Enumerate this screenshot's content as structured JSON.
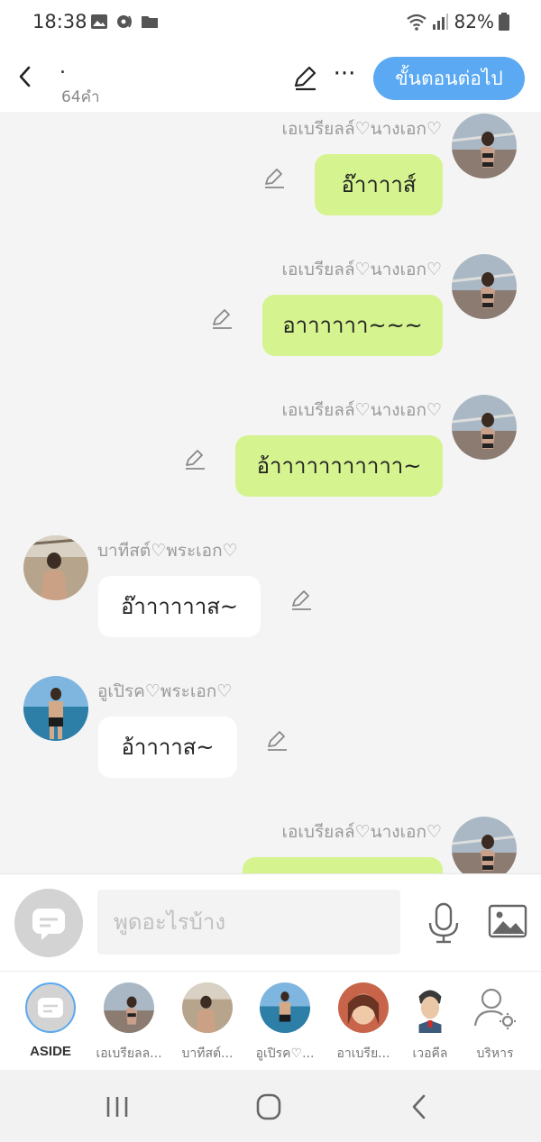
{
  "status_bar": {
    "time": "18:38",
    "battery": "82%"
  },
  "header": {
    "title": ".",
    "word_count": "64คำ",
    "next_label": "ขั้นตอนต่อไป"
  },
  "messages": [
    {
      "sender": "เอเบรียลล์♡นางเอก♡",
      "text": "อ๊าาาาส์",
      "side": "right"
    },
    {
      "sender": "เอเบรียลล์♡นางเอก♡",
      "text": "อาาาาาา~~~",
      "side": "right"
    },
    {
      "sender": "เอเบรียลล์♡นางเอก♡",
      "text": "อ้าาาาาาาาาาา~",
      "side": "right"
    },
    {
      "sender": "บาทีสต์♡พระเอก♡",
      "text": "อ๊าาาาาาส~",
      "side": "left"
    },
    {
      "sender": "อูเปิรค♡พระเอก♡",
      "text": "อ้าาาาส~",
      "side": "left"
    },
    {
      "sender": "เอเบรียลล์♡นางเอก♡",
      "text": "",
      "side": "right"
    }
  ],
  "input": {
    "placeholder": "พูดอะไรบ้าง"
  },
  "characters": [
    {
      "label": "ASIDE"
    },
    {
      "label": "เอเบรียลล..."
    },
    {
      "label": "บาทีสต์..."
    },
    {
      "label": "อูเปิรค♡..."
    },
    {
      "label": "อาเบรีย..."
    },
    {
      "label": "เวอคีล"
    },
    {
      "label": "บริหาร"
    }
  ],
  "colors": {
    "accent": "#5aa9f2",
    "bubble_right": "#d5f48f",
    "bubble_left": "#ffffff",
    "chat_bg": "#f4f4f4"
  }
}
